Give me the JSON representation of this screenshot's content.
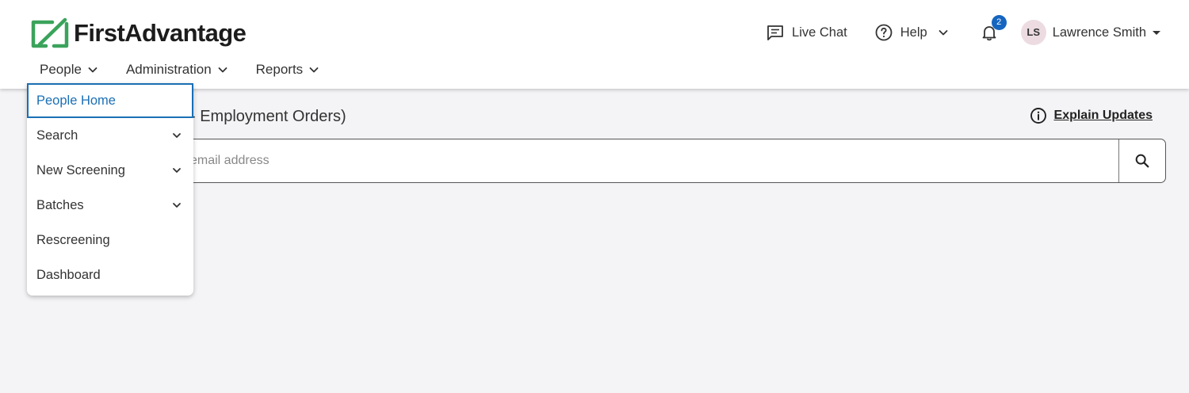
{
  "brand": {
    "name": "FirstAdvantage",
    "color": "#3aa35b"
  },
  "nav": [
    {
      "label": "People",
      "icon": "chevron-down-icon"
    },
    {
      "label": "Administration",
      "icon": "chevron-down-icon"
    },
    {
      "label": "Reports",
      "icon": "chevron-down-icon"
    }
  ],
  "header": {
    "live_chat": "Live Chat",
    "help": "Help",
    "notifications_count": "2",
    "user_initials": "LS",
    "user_name": "Lawrence Smith"
  },
  "main": {
    "heading_fragment": "- Employment Orders)",
    "explain_updates": "Explain Updates",
    "search_placeholder": "email address"
  },
  "people_menu": {
    "items": [
      {
        "label": "People Home",
        "active": true,
        "has_submenu": false
      },
      {
        "label": "Search",
        "active": false,
        "has_submenu": true
      },
      {
        "label": "New Screening",
        "active": false,
        "has_submenu": true
      },
      {
        "label": "Batches",
        "active": false,
        "has_submenu": true
      },
      {
        "label": "Rescreening",
        "active": false,
        "has_submenu": false
      },
      {
        "label": "Dashboard",
        "active": false,
        "has_submenu": false
      }
    ]
  },
  "colors": {
    "accent": "#1a6fb5",
    "badge": "#1565c0",
    "avatar_bg": "#ecdce2",
    "background": "#f4f4f6"
  }
}
